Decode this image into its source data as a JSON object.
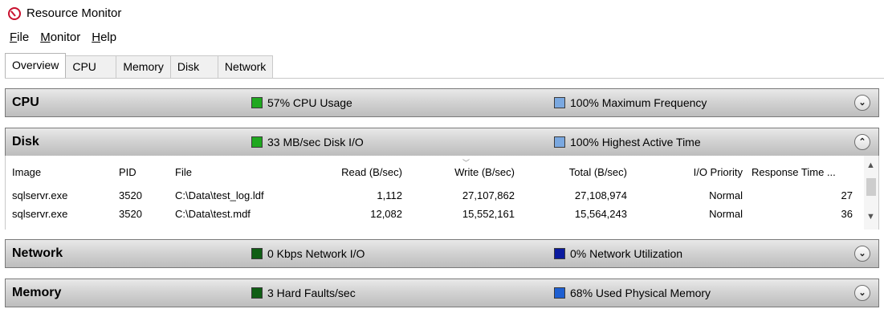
{
  "app": {
    "title": "Resource Monitor",
    "icon": "resource-monitor-icon"
  },
  "menu": [
    {
      "hotkey": "F",
      "rest": "ile"
    },
    {
      "hotkey": "M",
      "rest": "onitor"
    },
    {
      "hotkey": "H",
      "rest": "elp"
    }
  ],
  "tabs": [
    "Overview",
    "CPU",
    "Memory",
    "Disk",
    "Network"
  ],
  "active_tab": "Overview",
  "sections": {
    "cpu": {
      "title": "CPU",
      "metric1": {
        "text": "57% CPU Usage",
        "color": "#1fa81f"
      },
      "metric2": {
        "text": "100% Maximum Frequency",
        "color": "#7aa8e0"
      },
      "chevron": "⌄"
    },
    "disk": {
      "title": "Disk",
      "metric1": {
        "text": "33 MB/sec Disk I/O",
        "color": "#1fa81f"
      },
      "metric2": {
        "text": "100% Highest Active Time",
        "color": "#7aa8e0"
      },
      "chevron": "⌃"
    },
    "network": {
      "title": "Network",
      "metric1": {
        "text": "0 Kbps Network I/O",
        "color": "#0f5e14"
      },
      "metric2": {
        "text": "0% Network Utilization",
        "color": "#0a1a9e"
      },
      "chevron": "⌄"
    },
    "memory": {
      "title": "Memory",
      "metric1": {
        "text": "3 Hard Faults/sec",
        "color": "#0f5e14"
      },
      "metric2": {
        "text": "68% Used Physical Memory",
        "color": "#1e5fd1"
      },
      "chevron": "⌄"
    }
  },
  "disk_table": {
    "columns": [
      "Image",
      "PID",
      "File",
      "Read (B/sec)",
      "Write (B/sec)",
      "Total (B/sec)",
      "I/O Priority",
      "Response Time ..."
    ],
    "rows": [
      [
        "sqlservr.exe",
        "3520",
        "C:\\Data\\test_log.ldf",
        "1,112",
        "27,107,862",
        "27,108,974",
        "Normal",
        "27"
      ],
      [
        "sqlservr.exe",
        "3520",
        "C:\\Data\\test.mdf",
        "12,082",
        "15,552,161",
        "15,564,243",
        "Normal",
        "36"
      ]
    ]
  }
}
